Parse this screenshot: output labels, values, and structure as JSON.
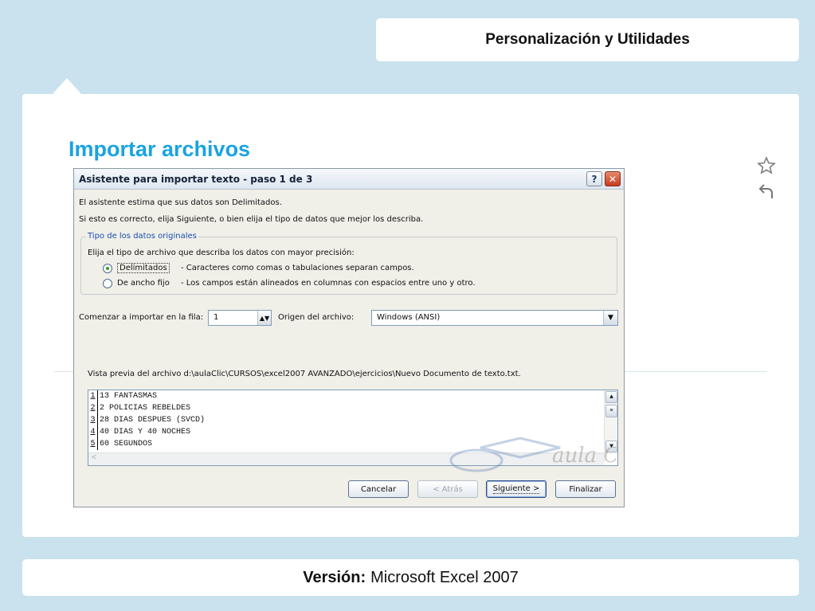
{
  "slide": {
    "header_title": "Personalización y Utilidades",
    "page_title": "Importar archivos",
    "footer_label": "Versión:",
    "footer_value": "Microsoft Excel 2007"
  },
  "dialog": {
    "title": "Asistente para importar texto - paso 1 de 3",
    "help_label": "?",
    "close_label": "✕",
    "line1": "El asistente estima que sus datos son Delimitados.",
    "line2": "Si esto es correcto, elija Siguiente, o bien elija el tipo de datos que mejor los describa.",
    "group_legend": "Tipo de los datos originales",
    "group_prompt": "Elija el tipo de archivo que describa los datos con mayor precisión:",
    "options": [
      {
        "label": "Delimitados",
        "desc": "- Caracteres como comas o tabulaciones separan campos.",
        "checked": true
      },
      {
        "label": "De ancho fijo",
        "desc": "- Los campos están alineados en columnas con espacios entre uno y otro.",
        "checked": false
      }
    ],
    "start_row_label": "Comenzar a importar en la fila:",
    "start_row_value": "1",
    "origin_label": "Origen del archivo:",
    "origin_value": "Windows (ANSI)",
    "preview_label": "Vista previa del archivo d:\\aulaClic\\CURSOS\\excel2007 AVANZADO\\ejercicios\\Nuevo Documento de texto.txt.",
    "preview_rows": [
      {
        "num": "1",
        "text": "13 FANTASMAS"
      },
      {
        "num": "2",
        "text": "2 POLICIAS REBELDES"
      },
      {
        "num": "3",
        "text": "28 DIAS DESPUES (SVCD)"
      },
      {
        "num": "4",
        "text": "40 DIAS Y 40 NOCHES"
      },
      {
        "num": "5",
        "text": "60 SEGUNDOS"
      }
    ],
    "buttons": {
      "cancel": "Cancelar",
      "back": "< Atrás",
      "next": "Siguiente >",
      "finish": "Finalizar"
    },
    "watermark_text": "aula Clic .com"
  },
  "colors": {
    "background": "#c9e2ee",
    "title_blue": "#1aa3e0"
  }
}
